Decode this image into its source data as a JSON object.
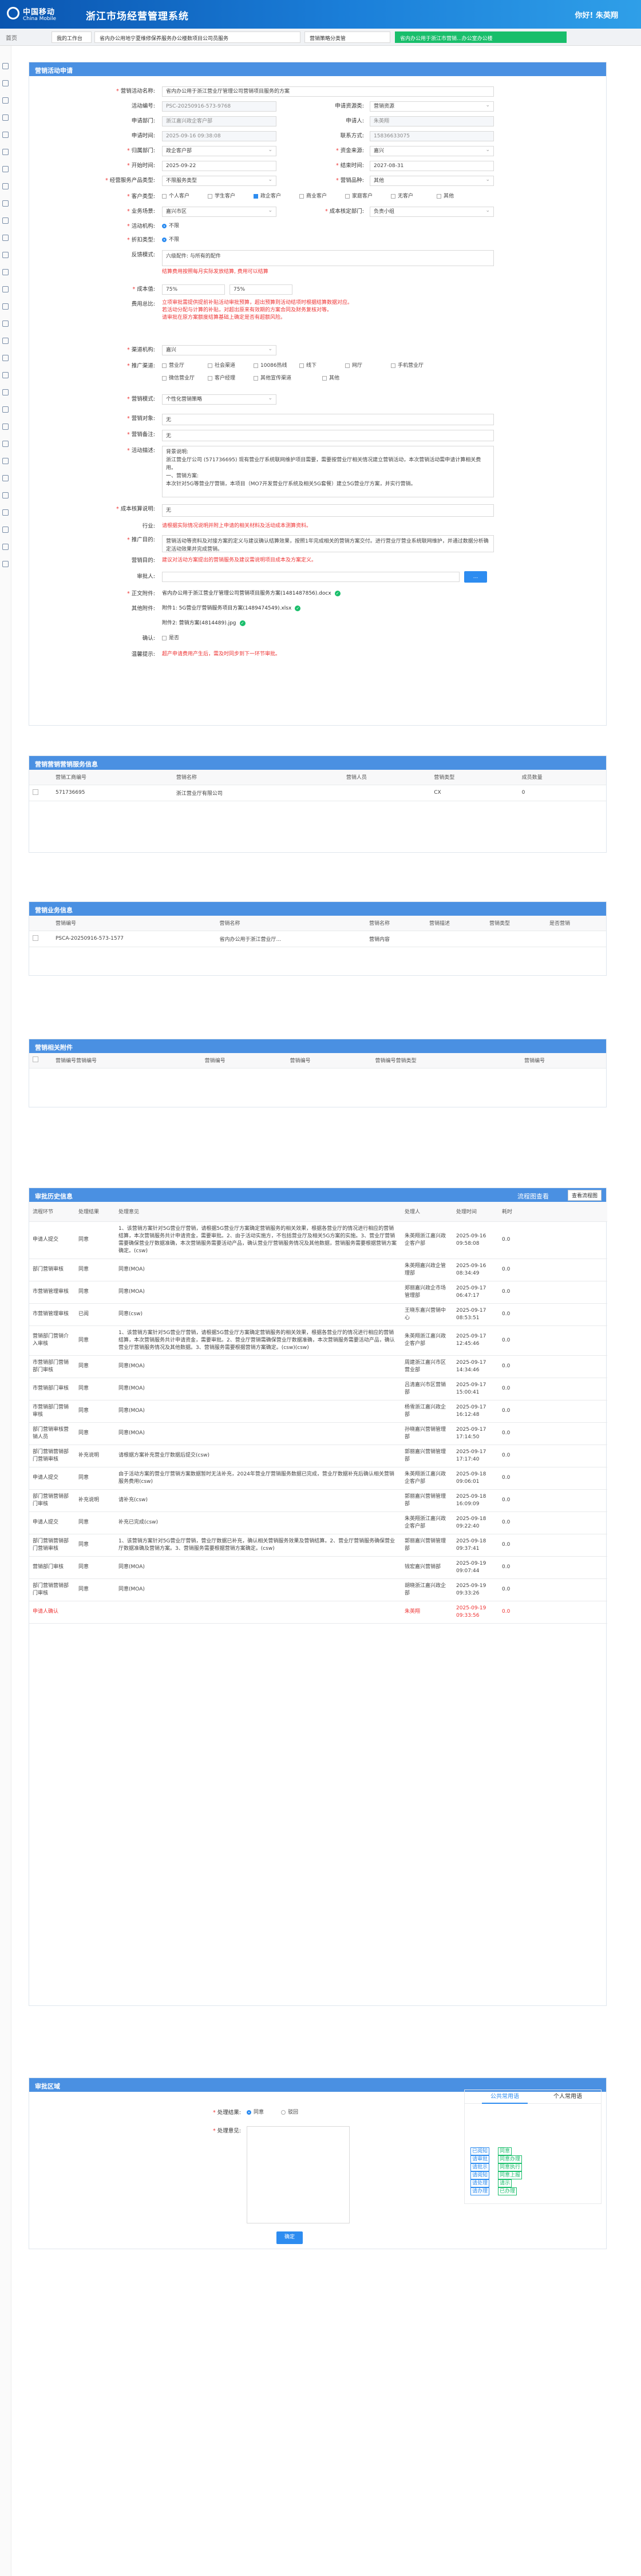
{
  "header": {
    "logo_cn": "中国移动",
    "logo_en": "China Mobile",
    "system_name": "浙江市场经营管理系统",
    "greeting": "你好! 朱英翔"
  },
  "tabs": {
    "home": "首页",
    "items": [
      "我的工作台",
      "省内办公用地宁夏维修保养服务办公楼数项目公司员服务",
      "营销策略分类管",
      "省内办公用于浙江市营销...办公室办公楼"
    ]
  },
  "form": {
    "title": "营销活动申请",
    "labels": {
      "activity_name": "营销活动名称:",
      "activity_code": "活动编号:",
      "apply_type": "申请资源类:",
      "apply_dept": "申请部门:",
      "applicant": "申请人:",
      "apply_time": "申请时间:",
      "contact_phone": "联系方式:",
      "belong_dept": "归属部门:",
      "fund_source": "资金来源:",
      "start_time": "开始时间:",
      "end_time": "结束时间:",
      "product": "经营服务产品类型:",
      "product_group": "营销品种:",
      "customer_type": "客户类型:",
      "business_scene": "业务场景:",
      "dept_activity": "部门活动:",
      "activity_area": "活动区域:",
      "auto_bind": "活动机构:",
      "discount": "折扣类型:",
      "budget_condition": "成本核定部门:",
      "industry": "行业:",
      "feedback": "反馈模式:",
      "media": "宣传媒介:",
      "channel": "渠道机构:",
      "channel2": "推广渠道:",
      "budget_type": "营销模式:",
      "attach_mode": "营销对象:",
      "remark": "营销备注:",
      "activity_desc": "活动描述:",
      "benefit": "成本核算说明:",
      "value": "成本值:",
      "ratio": "费用总比:",
      "purpose": "推广目的:",
      "reason": "营销目的:",
      "approval": "审批人:",
      "attachments": "正文附件:",
      "other": "其他附件:",
      "confirm": "确认:",
      "exception": "温馨提示:"
    },
    "values": {
      "activity_name": "省内办公用于浙江营业厅管理公司营销项目服务的方案",
      "activity_code": "PSC-20250916-573-9768",
      "apply_type": "营销资源",
      "apply_dept": "浙江嘉兴政企客户部",
      "applicant": "朱英翔",
      "apply_time": "2025-09-16 09:38:08",
      "contact_phone": "15836633075",
      "belong_dept": "政企客户部",
      "fund_source": "嘉兴",
      "start_time": "2025-09-22",
      "end_time": "2027-08-31",
      "product": "不限服务类型",
      "product_group": "其他",
      "business_scene": "嘉兴市区",
      "budget_condition": "负责小组",
      "auto_bind": "不限",
      "discount": "不限",
      "budget_text": "六级配件: 与所有的配件",
      "budget_note": "结算费用按照每月实际发放结算, 费用可以结算",
      "value": "75%",
      "ratio": "75%",
      "ratio_note": "立项审批需提供提前补贴活动审批预算，超出预算则活动结项时根据结算数据对应。\n若活动分配与计算的补贴，对超出原来有效期的方案合同及财务复核对等。\n请审批在原方案额度结算基础上确定是否有超额风险。",
      "channel": "嘉兴",
      "budget_type": "个性化营销策略",
      "attach_mode": "无",
      "remark": "无",
      "activity_desc": "背景说明:\n浙江营业厅公司 (571736695) 现有营业厅系统联网维护项目需要，需要按营业厅相关情况建立营销活动，本次营销活动需申请计算相关费用。\n一、营销方案:\n本次针对5G等营业厅营销，本项目（MO7开发营业厅系统及相关5G套餐）建立5G营业厅方案，并实行营销。",
      "benefit": "无",
      "purpose_note": "请根据实际情况说明并附上申请的相关材料及活动成本测算资料。",
      "purpose": "营销活动等资料及对接方案的定义与建议确认结算效果，按照1年完成相关的营销方案交付。进行营业厅营业系统联网维护，并通过数据分析确定活动效果并完成营销。",
      "reason_note": "建议对活动方案提出的营销服务及建议需说明项目成本及方案定义。",
      "attachment1": "省内办公用于浙江营业厅管理公司营销项目服务方案(1481487856).docx",
      "attachment2": "附件1: 5G营业厅营销服务项目方案(1489474549).xlsx",
      "attachment3": "附件2: 营销方案(4814489).jpg",
      "confirm": "是否",
      "exception_text": "超产申请费用产生后，需及时同步到下一环节审批。"
    },
    "options": {
      "customer_type": [
        "个人客户",
        "学生客户",
        "政企客户",
        "商业客户",
        "家庭客户",
        "无客户",
        "其他"
      ],
      "industry": [
        "营业厅",
        "社会渠道",
        "10086热线",
        "线下",
        "网厅",
        "手机营业厅",
        "微信营业厅",
        "客户经理",
        "其他宣传渠道",
        "其他"
      ],
      "budget_type": "个性化营销策略"
    }
  },
  "shop": {
    "title": "营销营销营销服务信息",
    "cols": [
      "营销工商编号",
      "营销名称",
      "营销人员",
      "营销类型",
      "成员数量"
    ],
    "rows": [
      [
        "571736695",
        "浙江营业厅有限公司",
        "",
        "CX",
        "0"
      ]
    ]
  },
  "product_info": {
    "title": "营销业务信息",
    "cols": [
      "营销编号",
      "营销名称",
      "营销名称",
      "营销描述",
      "营销类型",
      "是否营销"
    ],
    "rows": [
      [
        "PSCA-20250916-573-1577",
        "省内办公用于浙江营业厅...",
        "营销内容",
        "",
        "",
        ""
      ]
    ]
  },
  "attachments_tbl": {
    "title": "营销相关附件",
    "cols": [
      "营销编号营销编号",
      "营销编号",
      "营销编号",
      "营销编号营销类型",
      "营销编号"
    ]
  },
  "history": {
    "title": "审批历史信息",
    "link": "流程图查看",
    "btn": "查看流程图",
    "cols": [
      "流程环节",
      "处理结果",
      "处理意见",
      "处理人",
      "处理时间",
      "耗时"
    ],
    "rows": [
      [
        "申请人提交",
        "同意",
        "1、该营销方案针对5G营业厅营销，请根据5G营业厅方案确定营销服务的相关效果，根据各营业厅的情况进行相应的营销结算，本次营销服务共计申请资金，需要审批。2、由于活动实施方，不包括营业厅及相关5G方案的实施。3、营业厅营销需要确保营业厅数据准确，本次营销服务需要活动产品，确认营业厅营销服务情况及其他数据，营销服务需要根据营销方案确定。(csw)",
        "朱英翔浙江嘉兴政企客户部",
        "2025-09-16 09:58:08",
        "0.0"
      ],
      [
        "部门营销审核",
        "同意",
        "同意(MOA)",
        "朱英翔嘉兴政企管理部",
        "2025-09-16 08:34:49",
        "0.0"
      ],
      [
        "市营销管理审核",
        "同意",
        "同意(MOA)",
        "郑丽嘉兴政企市场管理部",
        "2025-09-17 06:47:17",
        "0.0"
      ],
      [
        "市营销管理审核",
        "已阅",
        "同意(csw)",
        "王晓东嘉兴营销中心",
        "2025-09-17 08:53:51",
        "0.0"
      ],
      [
        "营销部门营销介入审核",
        "同意",
        "1、该营销方案针对5G营业厅营销，请根据5G营业厅方案确定营销服务的相关效果，根据各营业厅的情况进行相应的营销结算，本次营销服务共计申请资金，需要审批。2、营业厅营销需确保营业厅数据准确，本次营销服务需要活动产品，确认营业厅营销服务情况及其他数据。3、营销服务需要根据营销方案确定。(csw)(csw)",
        "朱英翔浙江嘉兴政企客户部",
        "2025-09-17 12:45:46",
        "0.0"
      ],
      [
        "市营销部门营销部门审核",
        "同意",
        "同意(MOA)",
        "周建浙江嘉兴市区营业部",
        "2025-09-17 14:34:46",
        "0.0"
      ],
      [
        "市营销部门审核",
        "同意",
        "同意(MOA)",
        "吕清嘉兴市区营销部",
        "2025-09-17 15:00:41",
        "0.0"
      ],
      [
        "市营销部门营销审核",
        "同意",
        "同意(MOA)",
        "杨雪浙江嘉兴政企部",
        "2025-09-17 16:12:48",
        "0.0"
      ],
      [
        "部门营销审核营销人员",
        "同意",
        "同意(MOA)",
        "孙晓嘉兴营销管理部",
        "2025-09-17 17:14:50",
        "0.0"
      ],
      [
        "部门营销营销部门营销审核",
        "补充说明",
        "请根据方案补充营业厅数据后提交(csw)",
        "郭丽嘉兴营销管理部",
        "2025-09-17 17:17:40",
        "0.0"
      ],
      [
        "申请人提交",
        "同意",
        "由于活动方案的营业厅营销方案数据暂时无法补充，2024年营业厅营销服务数据已完成，营业厅数据补充后确认相关营销服务费用(csw)",
        "朱英翔浙江嘉兴政企客户部",
        "2025-09-18 09:06:01",
        "0.0"
      ],
      [
        "部门营销营销部门审核",
        "补充说明",
        "请补充(csw)",
        "郭丽嘉兴营销管理部",
        "2025-09-18 16:09:09",
        "0.0"
      ],
      [
        "申请人提交",
        "同意",
        "补充已完成(csw)",
        "朱英翔浙江嘉兴政企客户部",
        "2025-09-18 09:22:40",
        "0.0"
      ],
      [
        "部门营销营销部门营销审核",
        "同意",
        "1、该营销方案针对5G营业厅营销，营业厅数据已补充，确认相关营销服务效果及营销结算。2、营业厅营销服务确保营业厅数据准确及营销方案。3、营销服务需要根据营销方案确定。(csw)",
        "郭丽嘉兴营销管理部",
        "2025-09-18 09:37:41",
        "0.0"
      ],
      [
        "营销部门审核",
        "同意",
        "同意(MOA)",
        "钱宏嘉兴营销部",
        "2025-09-19 09:07:44",
        "0.0"
      ],
      [
        "部门营销营销部门审核",
        "同意",
        "同意(MOA)",
        "胡晓浙江嘉兴政企部",
        "2025-09-19 09:33:26",
        "0.0"
      ],
      [
        "申请人确认",
        "",
        "",
        "朱英翔",
        "2025-09-19 09:33:56",
        "0.0"
      ]
    ]
  },
  "approve": {
    "title": "审批区域",
    "result_label": "处理结果:",
    "result_opts": [
      "同意",
      "驳回"
    ],
    "opinion_label": "处理意见:",
    "submit": "确定",
    "tabs": [
      "公共常用语",
      "个人常用语"
    ],
    "phrases_blue": [
      "已阅知",
      "请审批",
      "请批示",
      "请阅知",
      "请处理",
      "请办理"
    ],
    "phrases_green": [
      "同意",
      "同意办理",
      "同意执行",
      "同意上报",
      "请示",
      "已办理"
    ]
  }
}
